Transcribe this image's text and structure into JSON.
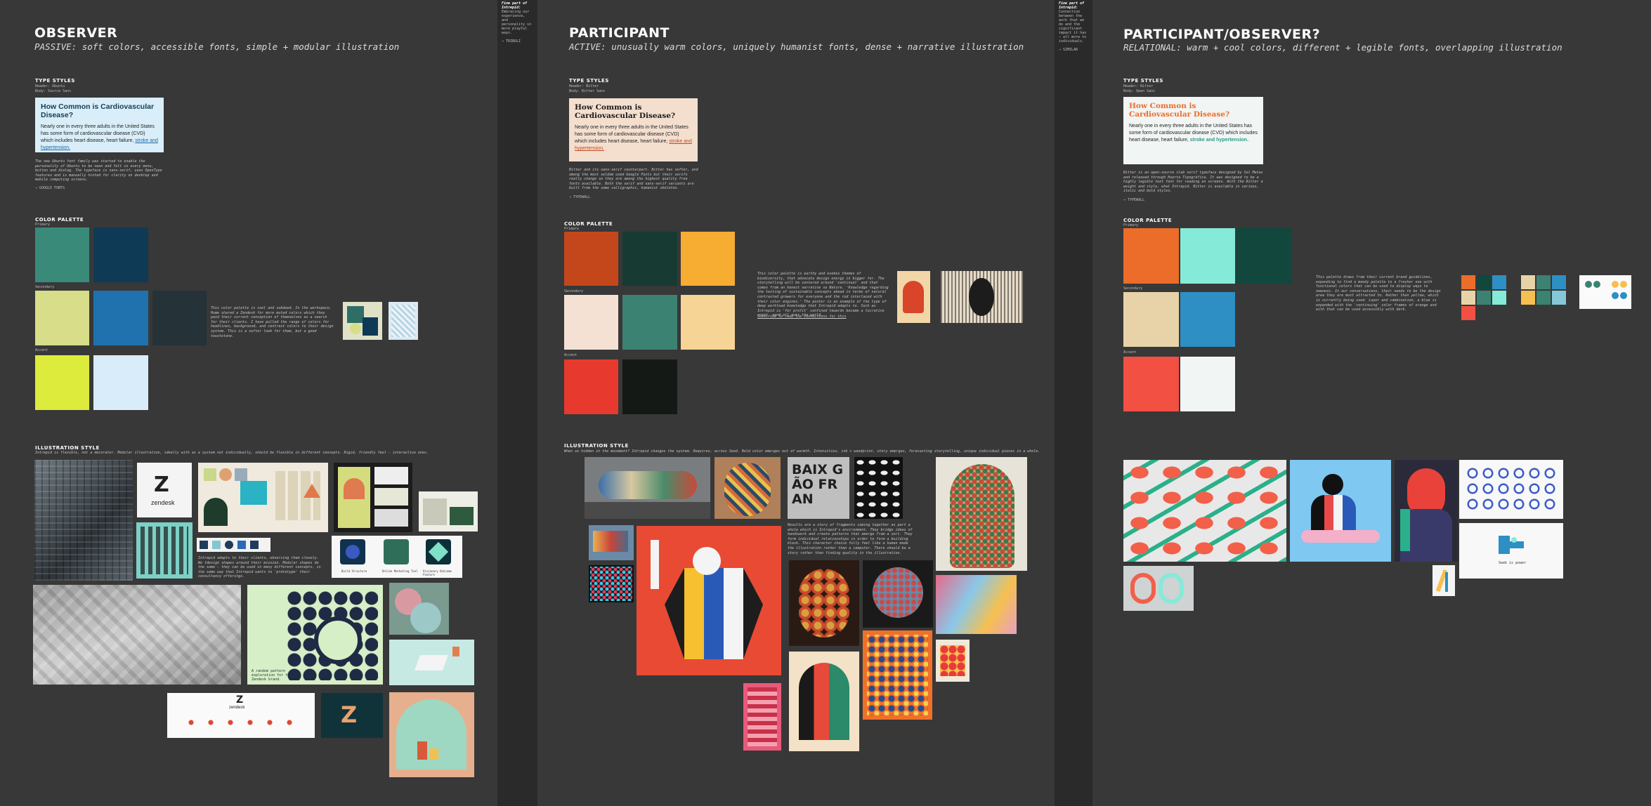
{
  "gutters": {
    "left": {
      "heading": "Fine part of Intrepid:",
      "body": "Embracing our experience, and personality in more playful ways.",
      "link": "→ TRIBULI"
    },
    "right": {
      "heading": "Fine part of Intrepid:",
      "body": "Connection between the work that we do and the significant impact it has — all more to individuals.",
      "link": "→ SIMILAR"
    }
  },
  "observer": {
    "title": "OBSERVER",
    "subtitle": "PASSIVE: soft colors, accessible fonts, simple + modular illustration",
    "type_heading": "TYPE STYLES",
    "type_meta": "Header: Ubuntu\nBody: Source Sans",
    "card": {
      "title": "How Common is Cardiovascular Disease?",
      "body": "Nearly one in every three adults in the United States has some form of cardiovascular disease (CVD) which includes heart disease, heart failure, ",
      "link": "stroke and hypertension."
    },
    "type_note": "The new Ubuntu font family was started to enable the personality of Ubuntu to be seen and felt in every menu, button and dialog. The typeface is sans-serif, uses OpenType features and is manually hinted for clarity on desktop and mobile computing screens.",
    "type_link": "→ GOOGLE FONTS",
    "palette_heading": "COLOR PALETTE",
    "primary": "Primary",
    "secondary": "Secondary",
    "accent": "Accent",
    "colors": {
      "p1": "#3a8a7a",
      "p2": "#0f3a55",
      "s1": "#d7dd88",
      "s2": "#1f72ad",
      "s3": "#253237",
      "a1": "#dceb3c",
      "a2": "#d9ecf9"
    },
    "palette_note": "This color palette is cool and subdued. In the workspace, Hume shared a Zendesk for more muted colors which they paid their current conception of themselves as a search for their clients. I have pulled the range of colors for headlines, background, and contrast colors to their design system. This is a softer look for them, but a good touchstone.",
    "illus_heading": "ILLUSTRATION STYLE",
    "illus_note": "Intrepid is flexible, not a decorator. Modular illustration, ideally with as a system not individually, should be flexible in different concepts. Rigid, friendly feel — interactive ones.",
    "illus_note2": "Intrepid adapts to their clients, observing them closely. We tdesign shapes around their mission. Modular shapes do the same — they can be used in many different concepts, in the same way that Intrepid wants to 'prototype' their consultancy offerings.",
    "zd_logo": "zendesk",
    "pattern_caption": "A random pattern exploration for the new Zendesk brand.",
    "icon_captions": [
      "Build Structure",
      "Online Marketing Tool",
      "Visionary Outcome Feature"
    ]
  },
  "participant": {
    "title": "PARTICIPANT",
    "subtitle": "ACTIVE: unusually warm colors, uniquely humanist fonts, dense + narrative illustration",
    "type_heading": "TYPE STYLES",
    "type_meta": "Header: Bitter\nBody: Bitter Sans",
    "card": {
      "title": "How Common is Cardiovascular Disease?",
      "body": "Nearly one in every three adults in the United States has some form of cardiovascular disease (CVD) which includes heart disease, heart failure, ",
      "link": "stroke and hypertension."
    },
    "type_note": "Bitter and its sans-serif counterpart. Bitter has softer, and among the most seldom used Google Fonts but their serifs really change so they are among the highest quality free fonts available. Both the serif and sans-serif variants are built from the same calligraphic, humanist skeleton.",
    "type_link": "→ TYPEWALL",
    "palette_heading": "COLOR PALETTE",
    "primary": "Primary",
    "secondary": "Secondary",
    "accent": "Accent",
    "colors": {
      "p1": "#c4471c",
      "p2": "#173b33",
      "p3": "#f6ad32",
      "s1": "#f5e1d3",
      "s2": "#3b8273",
      "s3": "#f6d495",
      "a1": "#e8392e",
      "a2": "#151915"
    },
    "palette_note": "This color palette is earthy and evokes themes of biodiversity, that advocate design energy in bigger for. The storytelling will be centered around 'continual' and that comes from an honest narrative so Nature. 'Knowledge regarding the testing of sustainable concepts ahead in terms of natural contrasted growers for everyone and the rod interlaced with their color engines.' The poster is an example of the type of deep workload knowledge that Intrepid adapts to. Such as Intrepid is 'for profit' confined towards become a lucrative asset, send all over the world.",
    "palette_link": "Subscribe to read the connections for this",
    "illus_heading": "ILLUSTRATION STYLE",
    "illus_note": "When so hidden in the movement? Intrepid changes the system. Requires, across Seed. Bold color emerges out of warmth. Intensities, ink + woodprint, story emerges, forecasting storytelling, unique individual pieces in a whole.",
    "illus_note2": "Results are a story of fragments coming together as part a whole which is Intrepid's environment. They bridge ideas of handiwork and create patterns that emerge from a sort. They form individual relationships in order to form a building block. This character choice fully feel like a human made the illustration rather than a computer. There should be a story rather than finding quality in the illustration.",
    "street_text": "BAIX GÃO FRAN"
  },
  "relational": {
    "title": "PARTICIPANT/OBSERVER?",
    "subtitle": "RELATIONAL: warm + cool colors, different + legible fonts, overlapping illustration",
    "type_heading": "TYPE STYLES",
    "type_meta": "Header: Bitter\nBody: Open Sans",
    "card": {
      "title": "How Common is Cardiovascular Disease?",
      "body": "Nearly one in every three adults in the United States has some form of cardiovascular disease (CVD) which includes heart disease, heart failure, ",
      "link": "stroke and hypertension."
    },
    "type_note": "Bitter is an open-source slab serif typeface designed by Sol Matas and released through Huerta Tipográfica. It was designed to be a highly legible text font for reading on screens. With the Bitter a weight and style, what Intrepid. Bitter is available in various, italic and bold styles.",
    "type_link": "→ TYPEWALL",
    "palette_heading": "COLOR PALETTE",
    "primary": "Primary",
    "secondary": "Secondary",
    "accent": "Accent",
    "colors": {
      "p1": "#ec6c2a",
      "p2": "#86ead8",
      "p3": "#11473d",
      "s1": "#e8d3a9",
      "s2": "#2d8fc4",
      "a1": "#f25043",
      "a2": "#f1f5f4"
    },
    "palette_note": "This palette draws from their current brand guidelines, expanding to find a moody palette to a fresher one with functional colors that can be used to display ways to newness. In our conversations, their needs to be the design area they are most attracted to. Rather than yellow, which is currently being used. Layer and combination, a blue is expanded with the 'continuing' color frames of orange and with that can be used accessibly with dark.",
    "logo_text": "Seek is power"
  }
}
